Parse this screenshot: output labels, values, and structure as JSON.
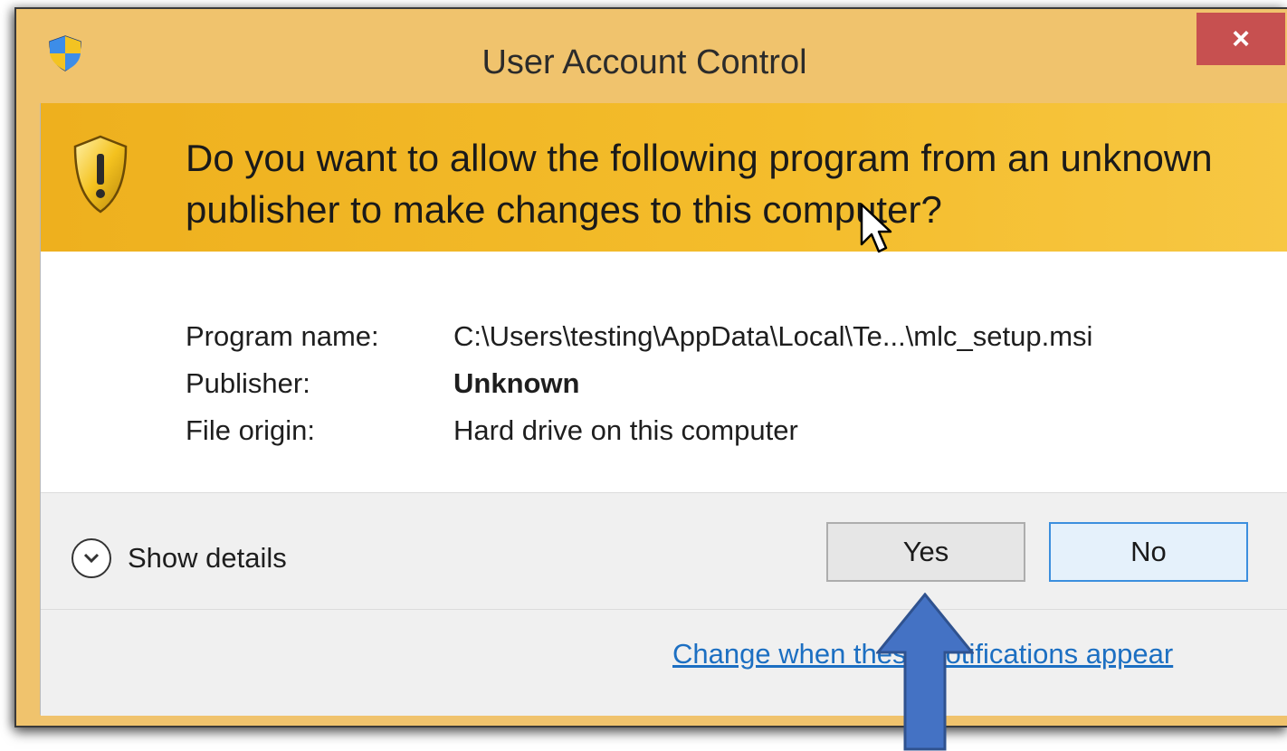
{
  "window": {
    "title": "User Account Control",
    "close_label": "×"
  },
  "banner": {
    "question": "Do you want to allow the following program from an unknown publisher to make changes to this computer?"
  },
  "info": {
    "rows": [
      {
        "label": "Program name:",
        "value": "C:\\Users\\testing\\AppData\\Local\\Te...\\mlc_setup.msi"
      },
      {
        "label": "Publisher:",
        "value": "Unknown"
      },
      {
        "label": "File origin:",
        "value": "Hard drive on this computer"
      }
    ]
  },
  "footer": {
    "show_details_label": "Show details",
    "yes_label": "Yes",
    "no_label": "No",
    "change_link": "Change when these notifications appear"
  },
  "icons": {
    "title_icon": "uac-shield-icon",
    "banner_icon": "warning-shield-icon",
    "details_icon": "chevron-down-icon",
    "annotation": "blue-arrow-up",
    "cursor": "mouse-pointer-icon"
  },
  "colors": {
    "frame": "#f0c36d",
    "banner": "#f4bd2c",
    "close": "#c75050",
    "link": "#1c6fc2",
    "default_button_border": "#3c8fde",
    "annotation_arrow": "#4472c4"
  }
}
